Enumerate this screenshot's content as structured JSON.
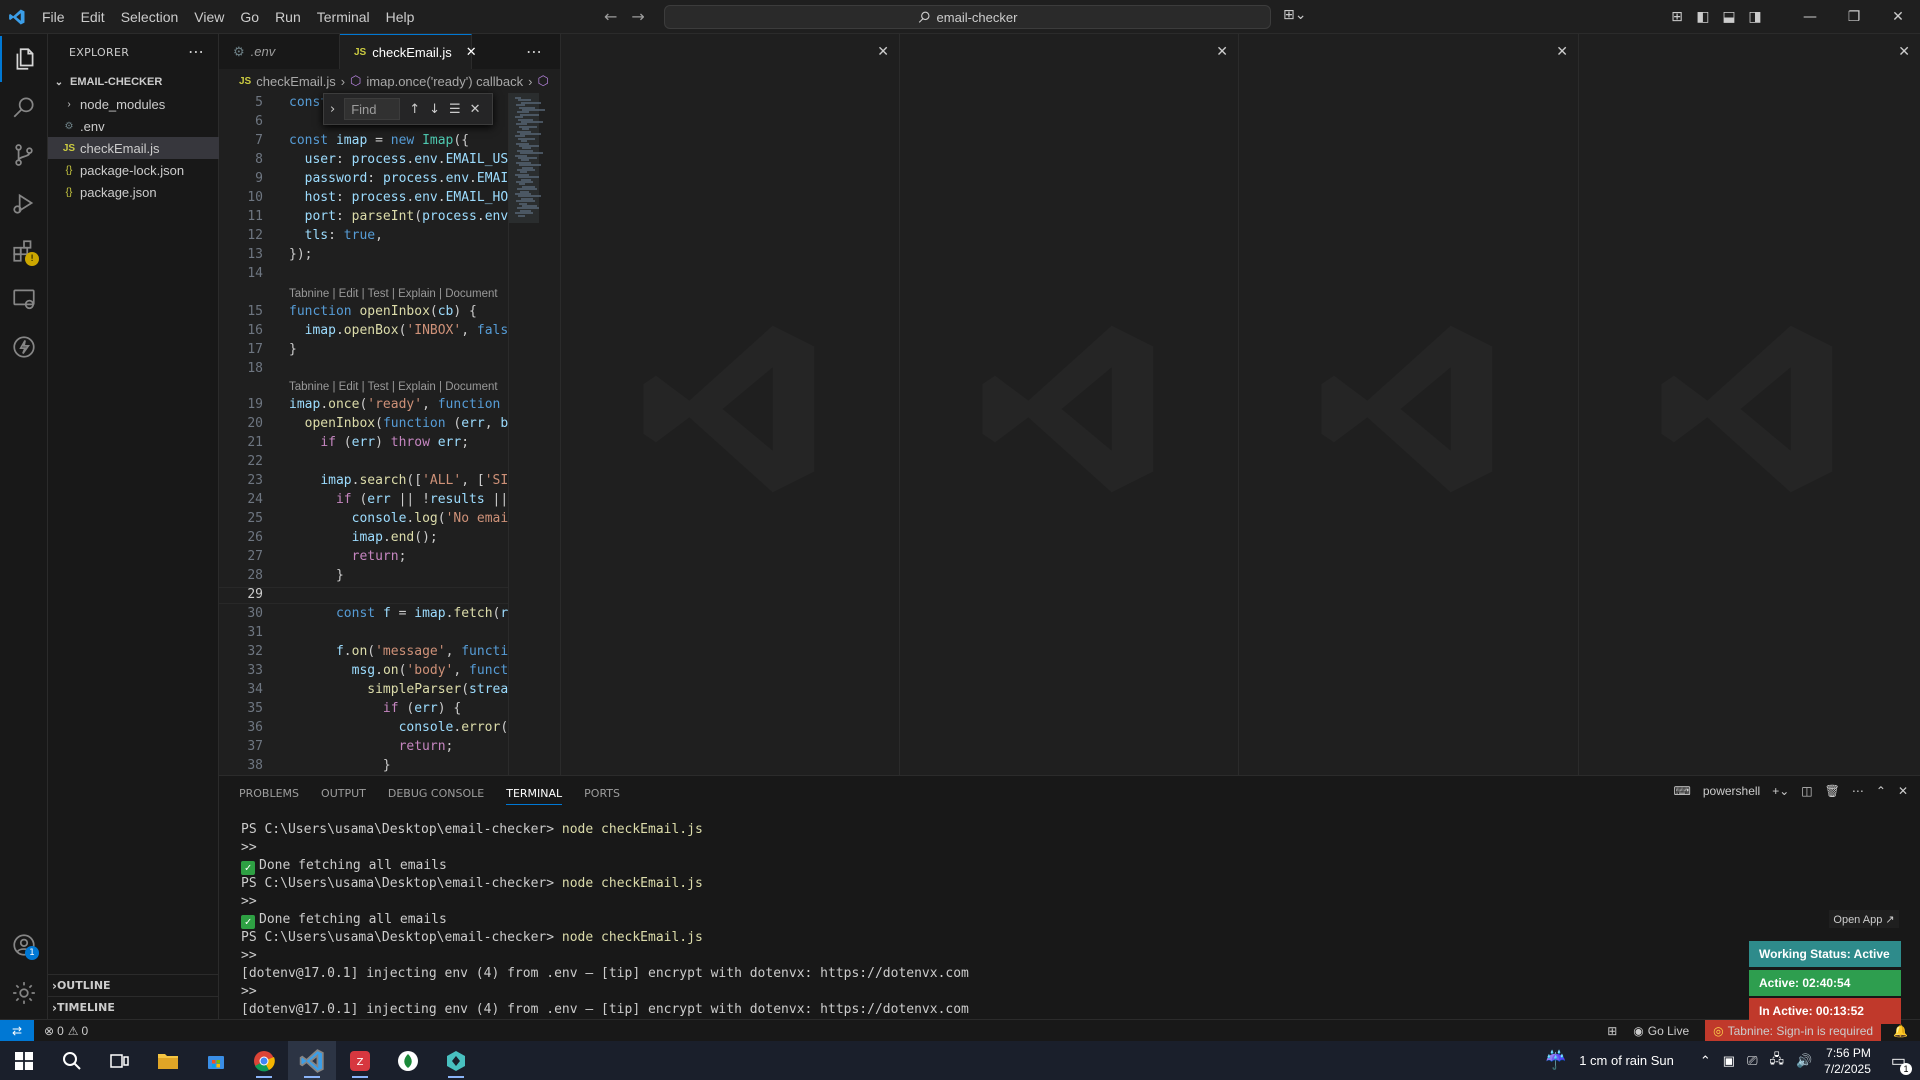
{
  "titlebar": {
    "menu": [
      "File",
      "Edit",
      "Selection",
      "View",
      "Go",
      "Run",
      "Terminal",
      "Help"
    ],
    "search": "email-checker"
  },
  "explorer": {
    "title": "EXPLORER",
    "folder": "EMAIL-CHECKER",
    "items": [
      {
        "label": "node_modules",
        "icon": "chevron-right-icon"
      },
      {
        "label": ".env",
        "icon": "gear-icon"
      },
      {
        "label": "checkEmail.js",
        "icon": "js-file-icon"
      },
      {
        "label": "package-lock.json",
        "icon": "json-file-icon"
      },
      {
        "label": "package.json",
        "icon": "json-file-icon"
      }
    ],
    "outline": "OUTLINE",
    "timeline": "TIMELINE"
  },
  "tabs": [
    {
      "label": ".env"
    },
    {
      "label": "checkEmail.js"
    }
  ],
  "breadcrumb": {
    "file": "checkEmail.js",
    "symbol": "imap.once('ready') callback"
  },
  "find": {
    "placeholder": "Find"
  },
  "codelens": "Tabnine | Edit | Test | Explain | Document",
  "editor": {
    "line_numbers": [
      "5",
      "6",
      "7",
      "8",
      "9",
      "10",
      "11",
      "12",
      "13",
      "14",
      "15",
      "16",
      "17",
      "18",
      "19",
      "20",
      "21",
      "22",
      "23",
      "24",
      "25",
      "26",
      "27",
      "28",
      "29",
      "30",
      "31",
      "32",
      "33",
      "34",
      "35",
      "36",
      "37",
      "38"
    ],
    "current_line": "29"
  },
  "panel": {
    "tabs": [
      "PROBLEMS",
      "OUTPUT",
      "DEBUG CONSOLE",
      "TERMINAL",
      "PORTS"
    ],
    "shell": "powershell",
    "prompt": "PS C:\\Users\\usama\\Desktop\\email-checker>",
    "command": "node checkEmail.js",
    "continuation": ">>",
    "done": "Done fetching all emails",
    "dotenv": "[dotenv@17.0.1] injecting env (4) from .env – [tip] encrypt with dotenvx: https://dotenvx.com"
  },
  "widget": {
    "open_app": "Open App ↗",
    "status": "Working Status: Active",
    "active": "Active: 02:40:54",
    "inactive": "In Active: 00:13:52",
    "colors": {
      "status": "#2e8b8b",
      "active": "#2e9e4f",
      "inactive": "#c0392b"
    }
  },
  "statusbar": {
    "errors": "0",
    "warnings": "0",
    "golive": "Go Live",
    "tabnine": "Tabnine: Sign-in is required"
  },
  "taskbar": {
    "weather": "1 cm of rain Sun",
    "time": "7:56 PM",
    "date": "7/2/2025",
    "notif_count": "1"
  },
  "activity": {
    "accounts_badge": "1"
  }
}
